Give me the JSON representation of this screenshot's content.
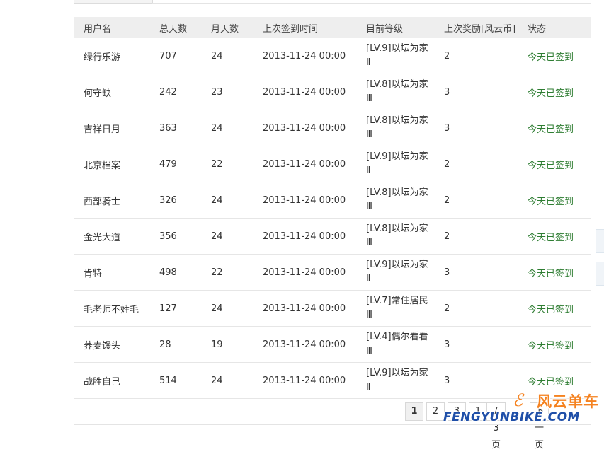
{
  "table": {
    "headers": [
      "用户名",
      "总天数",
      "月天数",
      "上次签到时间",
      "目前等级",
      "上次奖励[风云币]",
      "状态"
    ],
    "rows": [
      {
        "user": "绿行乐游",
        "total": "707",
        "month": "24",
        "last": "2013-11-24 00:00",
        "level": "[LV.9]以坛为家Ⅱ",
        "reward": "2",
        "status": "今天已签到"
      },
      {
        "user": "何守缺",
        "total": "242",
        "month": "23",
        "last": "2013-11-24 00:00",
        "level": "[LV.8]以坛为家Ⅲ",
        "reward": "3",
        "status": "今天已签到"
      },
      {
        "user": "吉祥日月",
        "total": "363",
        "month": "24",
        "last": "2013-11-24 00:00",
        "level": "[LV.8]以坛为家Ⅲ",
        "reward": "3",
        "status": "今天已签到"
      },
      {
        "user": "北京档案",
        "total": "479",
        "month": "22",
        "last": "2013-11-24 00:00",
        "level": "[LV.9]以坛为家Ⅱ",
        "reward": "2",
        "status": "今天已签到"
      },
      {
        "user": "西部骑士",
        "total": "326",
        "month": "24",
        "last": "2013-11-24 00:00",
        "level": "[LV.8]以坛为家Ⅲ",
        "reward": "2",
        "status": "今天已签到"
      },
      {
        "user": "金光大道",
        "total": "356",
        "month": "24",
        "last": "2013-11-24 00:00",
        "level": "[LV.8]以坛为家Ⅲ",
        "reward": "2",
        "status": "今天已签到"
      },
      {
        "user": "肯特",
        "total": "498",
        "month": "22",
        "last": "2013-11-24 00:00",
        "level": "[LV.9]以坛为家Ⅱ",
        "reward": "3",
        "status": "今天已签到"
      },
      {
        "user": "毛老师不姓毛",
        "total": "127",
        "month": "24",
        "last": "2013-11-24 00:00",
        "level": "[LV.7]常住居民Ⅲ",
        "reward": "2",
        "status": "今天已签到"
      },
      {
        "user": "荞麦馒头",
        "total": "28",
        "month": "19",
        "last": "2013-11-24 00:00",
        "level": "[LV.4]偶尔看看Ⅲ",
        "reward": "3",
        "status": "今天已签到"
      },
      {
        "user": "战胜自己",
        "total": "514",
        "month": "24",
        "last": "2013-11-24 00:00",
        "level": "[LV.9]以坛为家Ⅱ",
        "reward": "3",
        "status": "今天已签到"
      }
    ]
  },
  "pagination": {
    "pages": [
      "1",
      "2",
      "3"
    ],
    "current": "1",
    "jump_value": "1",
    "total_label": "/ 3 页",
    "next_label": "下一页"
  },
  "watermark": {
    "cn": "风云单车",
    "en": "FENGYUNBIKE.COM",
    "icon": "bicycle-logo-icon"
  },
  "colors": {
    "status": "#2e7d32",
    "header_bg": "#eeeeee",
    "watermark_orange": "#f58220",
    "watermark_blue": "#1f4fa8"
  }
}
